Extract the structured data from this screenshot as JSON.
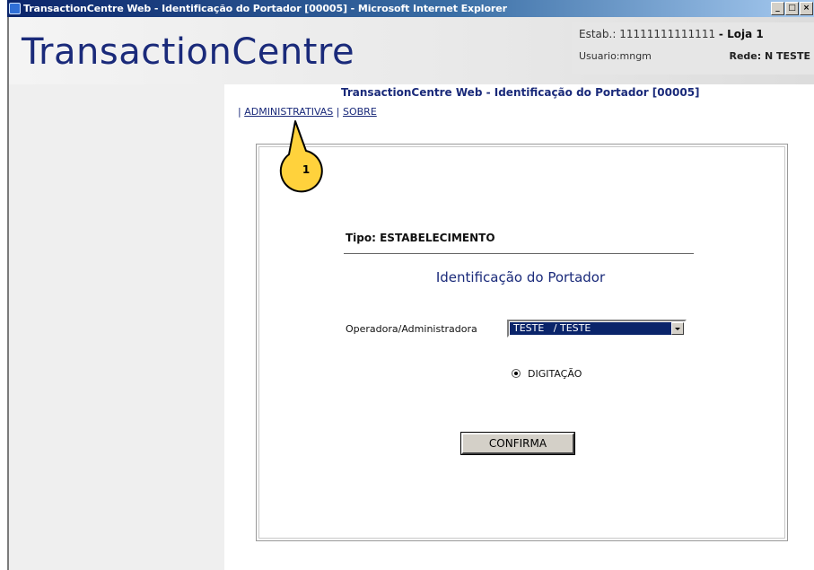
{
  "window": {
    "title": "TransactionCentre Web - Identificação do Portador [00005] - Microsoft Internet Explorer",
    "buttons": [
      "_",
      "□",
      "×"
    ]
  },
  "header": {
    "brand": "TransactionCentre",
    "estab_label": "Estab.:",
    "estab_value": "11111111111111",
    "loja": "- Loja 1",
    "usuario": "Usuario:mngm",
    "rede": "Rede:  N TESTE"
  },
  "page": {
    "title": "TransactionCentre Web - Identificação do Portador [00005]"
  },
  "nav": {
    "sep1": "| ",
    "administrativas": "ADMINISTRATIVAS",
    "sep2": " | ",
    "sobre": "SOBRE"
  },
  "form": {
    "tipo": "Tipo: ESTABELECIMENTO",
    "section_title": "Identificação do Portador",
    "operadora_label": "Operadora/Administradora",
    "operadora_value": "TESTE   / TESTE",
    "radio_label": "DIGITAÇÃO",
    "confirm_label": "CONFIRMA"
  },
  "callout": {
    "number": "1",
    "fill": "#ffd23c",
    "stroke": "#000000"
  },
  "colors": {
    "brand": "#1a2a7a",
    "selection": "#0a246a"
  }
}
